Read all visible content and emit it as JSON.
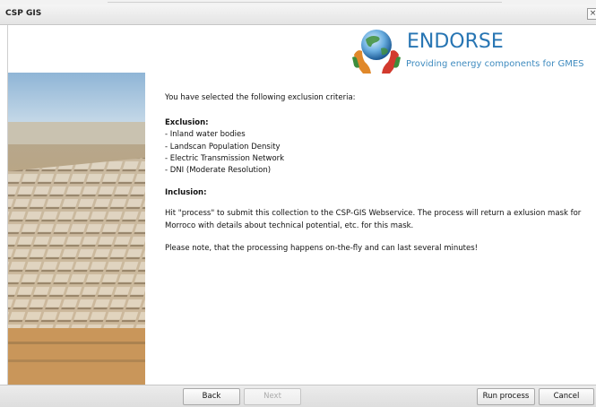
{
  "window": {
    "title": "CSP GIS",
    "close_glyph": "×"
  },
  "logo": {
    "icon": "globe-hands-icon",
    "name": "ENDORSE",
    "tagline": "Providing energy components for GMES"
  },
  "content": {
    "intro": "You have selected the following exclusion criteria:",
    "exclusion_heading": "Exclusion:",
    "exclusion_items": [
      "- Inland water bodies",
      "- Landscan Population Density",
      "- Electric Transmission Network",
      "- DNI (Moderate Resolution)"
    ],
    "inclusion_heading": "Inclusion:",
    "process_text": "Hit \"process\" to submit this collection to the CSP-GIS Webservice. The process will return a exlusion mask for Morroco with details about technical potential, etc. for this mask.",
    "note_text": "Please note, that the processing happens on-the-fly and can last several minutes!"
  },
  "buttons": {
    "back": "Back",
    "next": "Next",
    "run": "Run process",
    "cancel": "Cancel"
  },
  "colors": {
    "brand_blue": "#2775b3",
    "tagline_blue": "#3f8bbf"
  }
}
